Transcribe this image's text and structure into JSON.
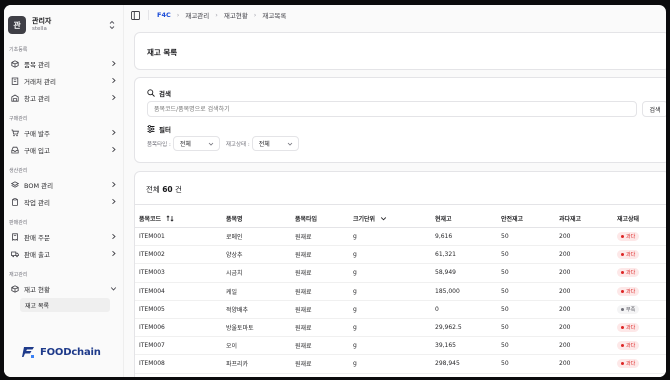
{
  "user": {
    "avatar_initial": "관",
    "name": "관리자",
    "id": "stella"
  },
  "nav": {
    "groups": [
      {
        "label": "기초등록",
        "items": [
          {
            "label": "품목 관리",
            "icon": "package-icon"
          },
          {
            "label": "거래처 관리",
            "icon": "building-icon"
          },
          {
            "label": "창고 관리",
            "icon": "warehouse-icon"
          }
        ]
      },
      {
        "label": "구매관리",
        "items": [
          {
            "label": "구매 발주",
            "icon": "cart-icon"
          },
          {
            "label": "구매 입고",
            "icon": "inbox-icon"
          }
        ]
      },
      {
        "label": "생산관리",
        "items": [
          {
            "label": "BOM 관리",
            "icon": "layers-icon"
          },
          {
            "label": "작업 관리",
            "icon": "clipboard-icon"
          }
        ]
      },
      {
        "label": "판매관리",
        "items": [
          {
            "label": "판매 주문",
            "icon": "receipt-icon"
          },
          {
            "label": "판매 출고",
            "icon": "truck-icon"
          }
        ]
      },
      {
        "label": "재고관리",
        "items": [
          {
            "label": "재고 현황",
            "icon": "box-icon",
            "expanded": true
          }
        ]
      }
    ],
    "sub_item": "재고 목록"
  },
  "logo": {
    "text": "FOODchain",
    "color": "#1e3a8a"
  },
  "breadcrumb": [
    "F4C",
    "재고관리",
    "재고현황",
    "재고목록"
  ],
  "page": {
    "title": "재고 목록"
  },
  "search": {
    "section_label": "검색",
    "placeholder": "품목코드/품목명으로 검색하기",
    "button": "검색"
  },
  "filter": {
    "section_label": "필터",
    "item_type_label": "품목타입 :",
    "item_type_value": "전체",
    "stock_status_label": "재고상태 :",
    "stock_status_value": "전체"
  },
  "table": {
    "total_prefix": "전체",
    "total_count": "60",
    "total_suffix": "건",
    "columns": [
      "품목코드",
      "품목명",
      "품목타입",
      "크기단위",
      "현재고",
      "안전재고",
      "과다재고",
      "재고상태"
    ],
    "rows": [
      [
        "ITEM001",
        "로메인",
        "원재료",
        "g",
        "9,616",
        "50",
        "200",
        "과다"
      ],
      [
        "ITEM002",
        "양상추",
        "원재료",
        "g",
        "61,321",
        "50",
        "200",
        "과다"
      ],
      [
        "ITEM003",
        "시금치",
        "원재료",
        "g",
        "58,949",
        "50",
        "200",
        "과다"
      ],
      [
        "ITEM004",
        "케일",
        "원재료",
        "g",
        "185,000",
        "50",
        "200",
        "과다"
      ],
      [
        "ITEM005",
        "적양배추",
        "원재료",
        "g",
        "0",
        "50",
        "200",
        "부족"
      ],
      [
        "ITEM006",
        "방울토마토",
        "원재료",
        "g",
        "29,962.5",
        "50",
        "200",
        "과다"
      ],
      [
        "ITEM007",
        "오이",
        "원재료",
        "g",
        "39,165",
        "50",
        "200",
        "과다"
      ],
      [
        "ITEM008",
        "파프리카",
        "원재료",
        "g",
        "298,945",
        "50",
        "200",
        "과다"
      ]
    ]
  },
  "colors": {
    "over": "#dc2626",
    "short": "#71717a",
    "accent": "#1d4ed8"
  }
}
